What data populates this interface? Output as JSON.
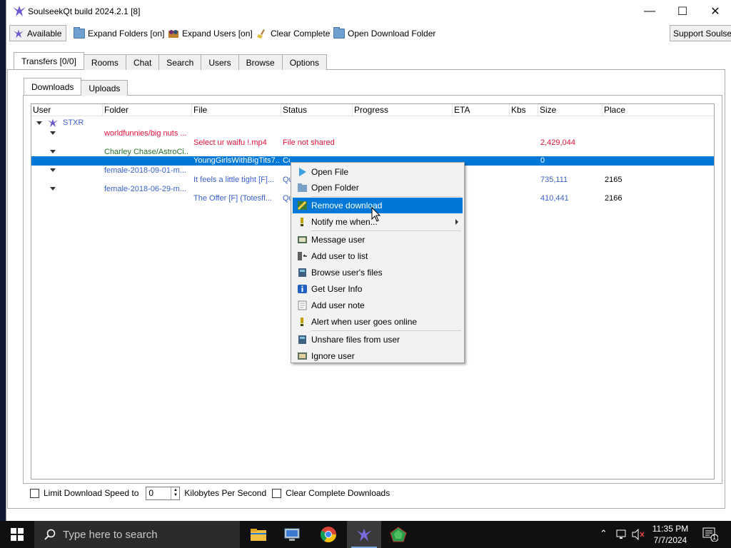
{
  "window": {
    "title": "SoulseekQt build 2024.2.1 [8]",
    "minimize": "—",
    "maximize": "☐",
    "close": "✕"
  },
  "toolbar": {
    "available": "Available",
    "expand_folders": "Expand Folders [on]",
    "expand_users": "Expand Users [on]",
    "clear_complete": "Clear Complete",
    "open_download_folder": "Open Download Folder",
    "support": "Support Soulseek"
  },
  "main_tabs": [
    "Transfers [0/0]",
    "Rooms",
    "Chat",
    "Search",
    "Users",
    "Browse",
    "Options"
  ],
  "sub_tabs": [
    "Downloads",
    "Uploads"
  ],
  "columns": [
    "User",
    "Folder",
    "File",
    "Status",
    "Progress",
    "ETA",
    "Kbs",
    "Size",
    "Place"
  ],
  "user": "STXR",
  "rows": [
    {
      "folder": "worldfunnies/big nuts ...",
      "file": "Select ur waifu !.mp4",
      "status": "File not shared",
      "size": "2,429,044",
      "place": ""
    },
    {
      "folder": "Charley Chase/AstroCi...",
      "file": "YoungGirlsWithBigTits7...",
      "status": "Complete",
      "size": "0",
      "place": ""
    },
    {
      "folder": "female-2018-09-01-m...",
      "file": "It feels a little tight [F]...",
      "status": "Qu",
      "size": "735,111",
      "place": "2165"
    },
    {
      "folder": "female-2018-06-29-m...",
      "file": "The Offer [F] (Totesfl...",
      "status": "Qu",
      "size": "410,441",
      "place": "2166"
    }
  ],
  "footer": {
    "limit_label": "Limit Download Speed to",
    "limit_value": "0",
    "unit": "Kilobytes Per Second",
    "clear_label": "Clear Complete Downloads"
  },
  "context_menu": {
    "open_file": "Open File",
    "open_folder": "Open Folder",
    "remove_download": "Remove download",
    "notify_me": "Notify me when...",
    "message_user": "Message user",
    "add_user": "Add user to list",
    "browse_files": "Browse user's files",
    "get_info": "Get User Info",
    "add_note": "Add user note",
    "alert_online": "Alert when user goes online",
    "unshare": "Unshare files from user",
    "ignore": "Ignore user"
  },
  "taskbar": {
    "search_placeholder": "Type here to search",
    "time": "11:35 PM",
    "date": "7/7/2024",
    "notifications": "1"
  },
  "colors": {
    "selection": "#0078d7",
    "error_text": "#e0103a",
    "queued_text": "#3a5fcd",
    "complete_folder": "#2a6e2a"
  }
}
